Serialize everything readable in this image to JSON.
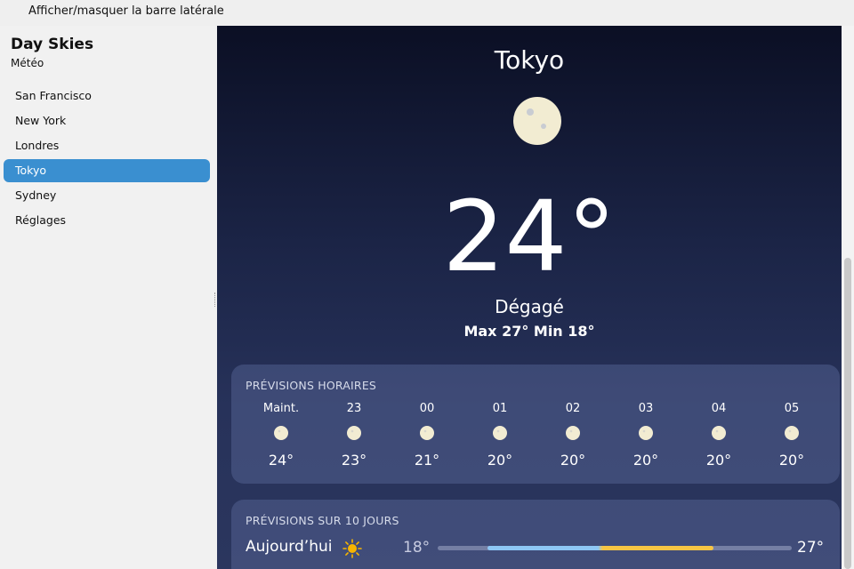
{
  "topbar": {
    "toggle_label": "Afficher/masquer la barre latérale"
  },
  "sidebar": {
    "title": "Day Skies",
    "subtitle": "Météo",
    "items": [
      {
        "label": "San Francisco",
        "active": false
      },
      {
        "label": "New York",
        "active": false
      },
      {
        "label": "Londres",
        "active": false
      },
      {
        "label": "Tokyo",
        "active": true
      },
      {
        "label": "Sydney",
        "active": false
      },
      {
        "label": "Réglages",
        "active": false
      }
    ]
  },
  "current": {
    "city": "Tokyo",
    "icon": "moon-icon",
    "temperature": "24°",
    "condition": "Dégagé",
    "hilo": "Max 27° Min 18°"
  },
  "hourly": {
    "title": "PRÉVISIONS HORAIRES",
    "hours": [
      {
        "label": "Maint.",
        "icon": "moon-icon",
        "temp": "24°"
      },
      {
        "label": "23",
        "icon": "moon-icon",
        "temp": "23°"
      },
      {
        "label": "00",
        "icon": "moon-icon",
        "temp": "21°"
      },
      {
        "label": "01",
        "icon": "moon-icon",
        "temp": "20°"
      },
      {
        "label": "02",
        "icon": "moon-icon",
        "temp": "20°"
      },
      {
        "label": "03",
        "icon": "moon-icon",
        "temp": "20°"
      },
      {
        "label": "04",
        "icon": "moon-icon",
        "temp": "20°"
      },
      {
        "label": "05",
        "icon": "moon-icon",
        "temp": "20°"
      }
    ]
  },
  "daily": {
    "title": "PRÉVISIONS SUR 10 JOURS",
    "days": [
      {
        "name": "Aujourd’hui",
        "icon": "sun-icon",
        "low": "18°",
        "high": "27°",
        "range_start": 0.14,
        "range_end": 0.78
      }
    ]
  },
  "colors": {
    "accent": "#3a8fd0",
    "moon": "#f2ecd2",
    "sun": "#f7b500",
    "range_cool": "#8ec7f5",
    "range_warm": "#f7c543"
  }
}
